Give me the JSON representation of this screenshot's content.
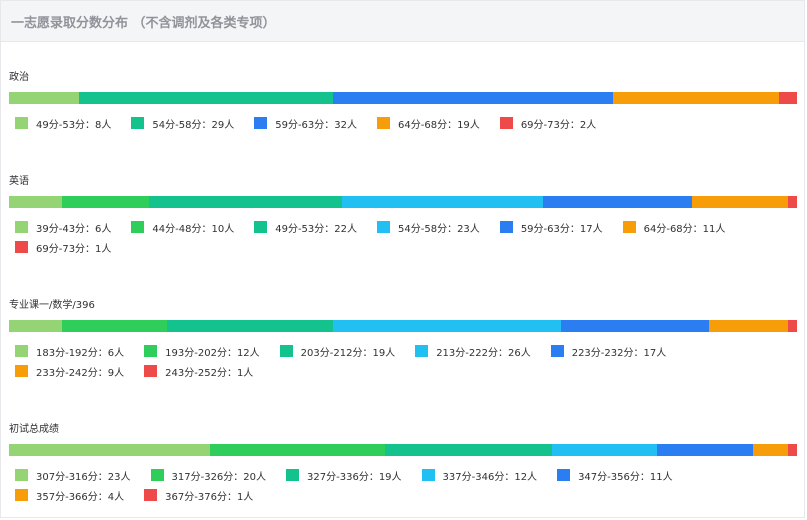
{
  "header": {
    "title": "一志愿录取分数分布 （不含调剂及各类专项）"
  },
  "chart_data": [
    {
      "type": "bar",
      "stacked": true,
      "orientation": "horizontal",
      "title": "政治",
      "series": [
        {
          "label": "49分-53分：8人",
          "value": 8,
          "color": "#95d475"
        },
        {
          "label": "54分-58分：29人",
          "value": 29,
          "color": "#13c28d"
        },
        {
          "label": "59分-63分：32人",
          "value": 32,
          "color": "#2b7ef1"
        },
        {
          "label": "64分-68分：19人",
          "value": 19,
          "color": "#f89d0a"
        },
        {
          "label": "69分-73分：2人",
          "value": 2,
          "color": "#ef4a4a"
        }
      ]
    },
    {
      "type": "bar",
      "stacked": true,
      "orientation": "horizontal",
      "title": "英语",
      "series": [
        {
          "label": "39分-43分：6人",
          "value": 6,
          "color": "#95d475"
        },
        {
          "label": "44分-48分：10人",
          "value": 10,
          "color": "#2fce5a"
        },
        {
          "label": "49分-53分：22人",
          "value": 22,
          "color": "#13c28d"
        },
        {
          "label": "54分-58分：23人",
          "value": 23,
          "color": "#22bff3"
        },
        {
          "label": "59分-63分：17人",
          "value": 17,
          "color": "#2b7ef1"
        },
        {
          "label": "64分-68分：11人",
          "value": 11,
          "color": "#f89d0a"
        },
        {
          "label": "69分-73分：1人",
          "value": 1,
          "color": "#ef4a4a"
        }
      ]
    },
    {
      "type": "bar",
      "stacked": true,
      "orientation": "horizontal",
      "title": "专业课一/数学/396",
      "series": [
        {
          "label": "183分-192分：6人",
          "value": 6,
          "color": "#95d475"
        },
        {
          "label": "193分-202分：12人",
          "value": 12,
          "color": "#2fce5a"
        },
        {
          "label": "203分-212分：19人",
          "value": 19,
          "color": "#13c28d"
        },
        {
          "label": "213分-222分：26人",
          "value": 26,
          "color": "#22bff3"
        },
        {
          "label": "223分-232分：17人",
          "value": 17,
          "color": "#2b7ef1"
        },
        {
          "label": "233分-242分：9人",
          "value": 9,
          "color": "#f89d0a"
        },
        {
          "label": "243分-252分：1人",
          "value": 1,
          "color": "#ef4a4a"
        }
      ]
    },
    {
      "type": "bar",
      "stacked": true,
      "orientation": "horizontal",
      "title": "初试总成绩",
      "series": [
        {
          "label": "307分-316分：23人",
          "value": 23,
          "color": "#95d475"
        },
        {
          "label": "317分-326分：20人",
          "value": 20,
          "color": "#2fce5a"
        },
        {
          "label": "327分-336分：19人",
          "value": 19,
          "color": "#13c28d"
        },
        {
          "label": "337分-346分：12人",
          "value": 12,
          "color": "#22bff3"
        },
        {
          "label": "347分-356分：11人",
          "value": 11,
          "color": "#2b7ef1"
        },
        {
          "label": "357分-366分：4人",
          "value": 4,
          "color": "#f89d0a"
        },
        {
          "label": "367分-376分：1人",
          "value": 1,
          "color": "#ef4a4a"
        }
      ]
    }
  ]
}
